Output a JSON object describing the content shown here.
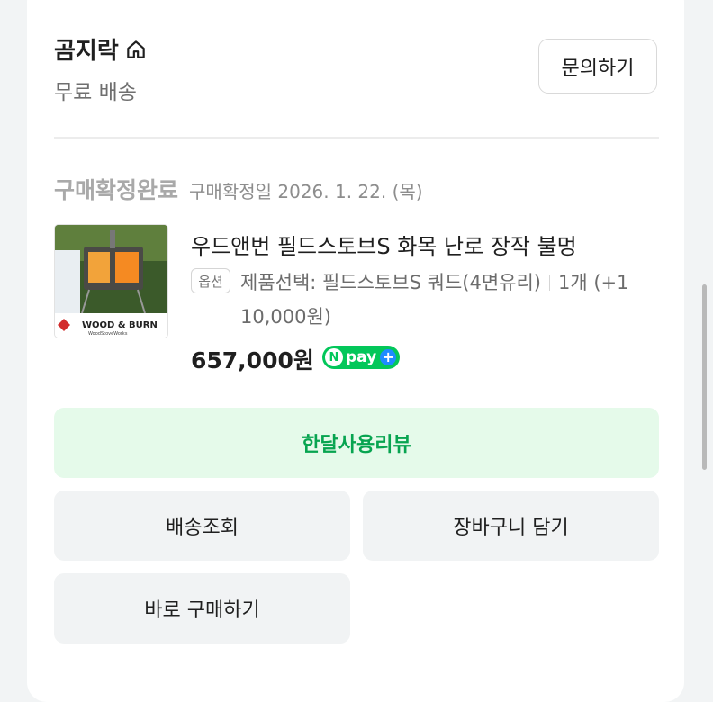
{
  "store": {
    "name": "곰지락",
    "shipping": "무료 배송",
    "inquiry_label": "문의하기"
  },
  "order": {
    "status": "구매확정완료",
    "confirm_date": "구매확정일 2026. 1. 22. (목)"
  },
  "product": {
    "title": "우드앤번 필드스토브S 화목 난로 장작 불멍",
    "option_badge": "옵션",
    "option_text": "제품선택: 필드스토브S 쿼드(4면유리)",
    "quantity_text": "1개 (+1",
    "option_extra": "10,000원)",
    "price": "657,000원",
    "thumbnail_brand": "WOOD & BURN",
    "thumbnail_sub": "WoodStoveWorks",
    "npay_label": "pay"
  },
  "actions": {
    "review": "한달사용리뷰",
    "track": "배송조회",
    "cart": "장바구니 담기",
    "buy_again": "바로 구매하기"
  },
  "colors": {
    "accent_green": "#03c75a",
    "review_bg": "#e5faea",
    "review_text": "#07a450"
  }
}
